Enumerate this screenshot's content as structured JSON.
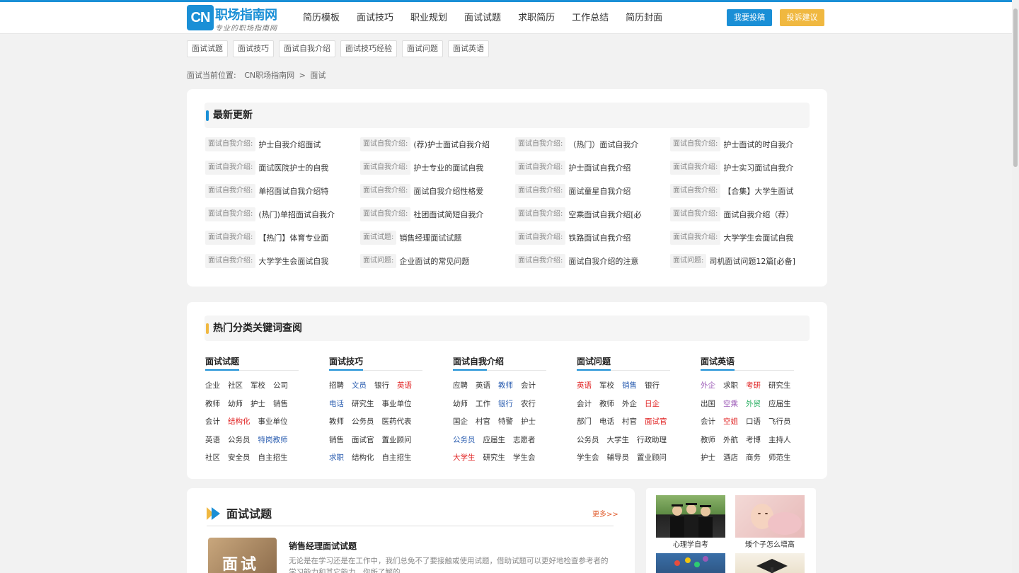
{
  "header": {
    "logo_cn": "CN",
    "logo_name": "职场指南网",
    "logo_slogan": "专业的职场指南网",
    "nav": [
      "简历模板",
      "面试技巧",
      "职业规划",
      "面试试题",
      "求职简历",
      "工作总结",
      "简历封面"
    ],
    "submit_label": "我要投稿",
    "complain_label": "投诉建议"
  },
  "tags": [
    "面试试题",
    "面试技巧",
    "面试自我介绍",
    "面试技巧经验",
    "面试问题",
    "面试英语"
  ],
  "breadcrumb": {
    "prefix": "面试当前位置:",
    "home": "CN职场指南网",
    "sep": ">",
    "current": "面试"
  },
  "latest": {
    "title": "最新更新",
    "items": [
      {
        "cat": "面试自我介绍:",
        "title": "护士自我介绍面试"
      },
      {
        "cat": "面试自我介绍:",
        "title": "(荐)护士面试自我介绍"
      },
      {
        "cat": "面试自我介绍:",
        "title": "（热门）面试自我介"
      },
      {
        "cat": "面试自我介绍:",
        "title": "护士面试的时自我介"
      },
      {
        "cat": "面试自我介绍:",
        "title": "面试医院护士的自我"
      },
      {
        "cat": "面试自我介绍:",
        "title": "护士专业的面试自我"
      },
      {
        "cat": "面试自我介绍:",
        "title": "护士面试自我介绍"
      },
      {
        "cat": "面试自我介绍:",
        "title": "护士实习面试自我介"
      },
      {
        "cat": "面试自我介绍:",
        "title": "单招面试自我介绍特"
      },
      {
        "cat": "面试自我介绍:",
        "title": "面试自我介绍性格爱"
      },
      {
        "cat": "面试自我介绍:",
        "title": "面试童星自我介绍"
      },
      {
        "cat": "面试自我介绍:",
        "title": "【合集】大学生面试"
      },
      {
        "cat": "面试自我介绍:",
        "title": "(热门)单招面试自我介"
      },
      {
        "cat": "面试自我介绍:",
        "title": "社团面试简短自我介"
      },
      {
        "cat": "面试自我介绍:",
        "title": "空乘面试自我介绍[必"
      },
      {
        "cat": "面试自我介绍:",
        "title": "面试自我介绍（荐）"
      },
      {
        "cat": "面试自我介绍:",
        "title": "【热门】体育专业面"
      },
      {
        "cat": "面试试题:",
        "title": "销售经理面试试题"
      },
      {
        "cat": "面试自我介绍:",
        "title": "铁路面试自我介绍"
      },
      {
        "cat": "面试自我介绍:",
        "title": "大学学生会面试自我"
      },
      {
        "cat": "面试自我介绍:",
        "title": "大学学生会面试自我"
      },
      {
        "cat": "面试问题:",
        "title": "企业面试的常见问题"
      },
      {
        "cat": "面试自我介绍:",
        "title": "面试自我介绍的注意"
      },
      {
        "cat": "面试问题:",
        "title": "司机面试问题12篇[必备]"
      }
    ]
  },
  "hot": {
    "title": "热门分类关键词查阅",
    "columns": [
      {
        "head": "面试试题",
        "rows": [
          [
            {
              "t": "企业",
              "c": "#333"
            },
            {
              "t": "社区",
              "c": "#333"
            },
            {
              "t": "军校",
              "c": "#333"
            },
            {
              "t": "公司",
              "c": "#333"
            }
          ],
          [
            {
              "t": "教师",
              "c": "#333"
            },
            {
              "t": "幼师",
              "c": "#333"
            },
            {
              "t": "护士",
              "c": "#333"
            },
            {
              "t": "销售",
              "c": "#333"
            }
          ],
          [
            {
              "t": "会计",
              "c": "#333"
            },
            {
              "t": "结构化",
              "c": "#e02020"
            },
            {
              "t": "事业单位",
              "c": "#333"
            }
          ],
          [
            {
              "t": "英语",
              "c": "#333"
            },
            {
              "t": "公务员",
              "c": "#333"
            },
            {
              "t": "特岗教师",
              "c": "#2a5db0"
            }
          ],
          [
            {
              "t": "社区",
              "c": "#333"
            },
            {
              "t": "安全员",
              "c": "#333"
            },
            {
              "t": "自主招生",
              "c": "#333"
            }
          ]
        ]
      },
      {
        "head": "面试技巧",
        "rows": [
          [
            {
              "t": "招聘",
              "c": "#333"
            },
            {
              "t": "文员",
              "c": "#2a5db0"
            },
            {
              "t": "银行",
              "c": "#333"
            },
            {
              "t": "英语",
              "c": "#e02020"
            }
          ],
          [
            {
              "t": "电话",
              "c": "#2a5db0"
            },
            {
              "t": "研究生",
              "c": "#333"
            },
            {
              "t": "事业单位",
              "c": "#333"
            }
          ],
          [
            {
              "t": "教师",
              "c": "#333"
            },
            {
              "t": "公务员",
              "c": "#333"
            },
            {
              "t": "医药代表",
              "c": "#333"
            }
          ],
          [
            {
              "t": "销售",
              "c": "#333"
            },
            {
              "t": "面试官",
              "c": "#333"
            },
            {
              "t": "置业顾问",
              "c": "#333"
            }
          ],
          [
            {
              "t": "求职",
              "c": "#2a5db0"
            },
            {
              "t": "结构化",
              "c": "#333"
            },
            {
              "t": "自主招生",
              "c": "#333"
            }
          ]
        ]
      },
      {
        "head": "面试自我介绍",
        "rows": [
          [
            {
              "t": "应聘",
              "c": "#333"
            },
            {
              "t": "英语",
              "c": "#333"
            },
            {
              "t": "教师",
              "c": "#2a5db0"
            },
            {
              "t": "会计",
              "c": "#333"
            }
          ],
          [
            {
              "t": "幼师",
              "c": "#333"
            },
            {
              "t": "工作",
              "c": "#333"
            },
            {
              "t": "银行",
              "c": "#2a5db0"
            },
            {
              "t": "农行",
              "c": "#333"
            }
          ],
          [
            {
              "t": "国企",
              "c": "#333"
            },
            {
              "t": "村官",
              "c": "#333"
            },
            {
              "t": "特警",
              "c": "#333"
            },
            {
              "t": "护士",
              "c": "#333"
            }
          ],
          [
            {
              "t": "公务员",
              "c": "#2a5db0"
            },
            {
              "t": "应届生",
              "c": "#333"
            },
            {
              "t": "志愿者",
              "c": "#333"
            }
          ],
          [
            {
              "t": "大学生",
              "c": "#e02020"
            },
            {
              "t": "研究生",
              "c": "#333"
            },
            {
              "t": "学生会",
              "c": "#333"
            }
          ]
        ]
      },
      {
        "head": "面试问题",
        "rows": [
          [
            {
              "t": "英语",
              "c": "#e02020"
            },
            {
              "t": "军校",
              "c": "#333"
            },
            {
              "t": "销售",
              "c": "#2a5db0"
            },
            {
              "t": "银行",
              "c": "#333"
            }
          ],
          [
            {
              "t": "会计",
              "c": "#333"
            },
            {
              "t": "教师",
              "c": "#333"
            },
            {
              "t": "外企",
              "c": "#333"
            },
            {
              "t": "日企",
              "c": "#e02020"
            }
          ],
          [
            {
              "t": "部门",
              "c": "#333"
            },
            {
              "t": "电话",
              "c": "#333"
            },
            {
              "t": "村官",
              "c": "#333"
            },
            {
              "t": "面试官",
              "c": "#e02020"
            }
          ],
          [
            {
              "t": "公务员",
              "c": "#333"
            },
            {
              "t": "大学生",
              "c": "#333"
            },
            {
              "t": "行政助理",
              "c": "#333"
            }
          ],
          [
            {
              "t": "学生会",
              "c": "#333"
            },
            {
              "t": "辅导员",
              "c": "#333"
            },
            {
              "t": "置业顾问",
              "c": "#333"
            }
          ]
        ]
      },
      {
        "head": "面试英语",
        "rows": [
          [
            {
              "t": "外企",
              "c": "#9b59b6"
            },
            {
              "t": "求职",
              "c": "#333"
            },
            {
              "t": "考研",
              "c": "#e02020"
            },
            {
              "t": "研究生",
              "c": "#333"
            }
          ],
          [
            {
              "t": "出国",
              "c": "#333"
            },
            {
              "t": "空乘",
              "c": "#9b59b6"
            },
            {
              "t": "外贸",
              "c": "#27ae60"
            },
            {
              "t": "应届生",
              "c": "#333"
            }
          ],
          [
            {
              "t": "会计",
              "c": "#333"
            },
            {
              "t": "空姐",
              "c": "#e02020"
            },
            {
              "t": "口语",
              "c": "#333"
            },
            {
              "t": "飞行员",
              "c": "#333"
            }
          ],
          [
            {
              "t": "教师",
              "c": "#333"
            },
            {
              "t": "外航",
              "c": "#333"
            },
            {
              "t": "考博",
              "c": "#333"
            },
            {
              "t": "主持人",
              "c": "#333"
            }
          ],
          [
            {
              "t": "护士",
              "c": "#333"
            },
            {
              "t": "酒店",
              "c": "#333"
            },
            {
              "t": "商务",
              "c": "#333"
            },
            {
              "t": "师范生",
              "c": "#333"
            }
          ]
        ]
      }
    ]
  },
  "section": {
    "title": "面试试题",
    "more": "更多>>",
    "thumb_text": "面试",
    "article_title": "销售经理面试试题",
    "article_desc": "无论是在学习还是在工作中，我们总免不了要接触或使用试题，借助试题可以更好地检查参考者的学习能力和其它能力。你所了解的"
  },
  "side_pics": [
    {
      "caption": "心理学自考"
    },
    {
      "caption": "矮个子怎么增高"
    }
  ],
  "colors": {
    "accent": "#1a8fd6",
    "orange": "#f0b840"
  }
}
